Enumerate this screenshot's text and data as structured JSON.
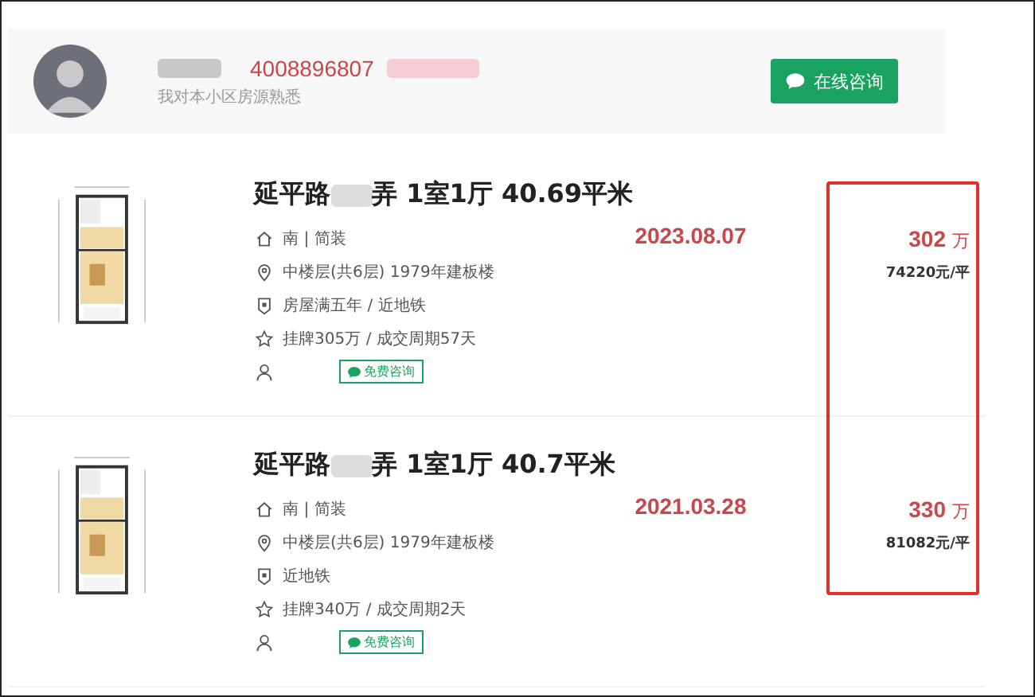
{
  "agent": {
    "phone": "4008896807",
    "intro": "我对本小区房源熟悉",
    "button": "在线咨询"
  },
  "listings": [
    {
      "title_prefix": "延平路",
      "title_suffix": "弄 1室1厅 40.69平米",
      "date": "2023.08.07",
      "price": "302",
      "price_unit": "万",
      "unit_price": "74220元/平",
      "features": [
        {
          "kind": "orientation",
          "text": "南 | 简装"
        },
        {
          "kind": "floor",
          "text": "中楼层(共6层) 1979年建板楼"
        },
        {
          "kind": "tag",
          "text": "房屋满五年 / 近地铁"
        },
        {
          "kind": "deal",
          "text": "挂牌305万 / 成交周期57天"
        }
      ],
      "consult_button": "免费咨询"
    },
    {
      "title_prefix": "延平路",
      "title_suffix": "弄 1室1厅 40.7平米",
      "date": "2021.03.28",
      "price": "330",
      "price_unit": "万",
      "unit_price": "81082元/平",
      "features": [
        {
          "kind": "orientation",
          "text": "南 | 简装"
        },
        {
          "kind": "floor",
          "text": "中楼层(共6层) 1979年建板楼"
        },
        {
          "kind": "tag",
          "text": "近地铁"
        },
        {
          "kind": "deal",
          "text": "挂牌340万 / 成交周期2天"
        }
      ],
      "consult_button": "免费咨询"
    }
  ]
}
